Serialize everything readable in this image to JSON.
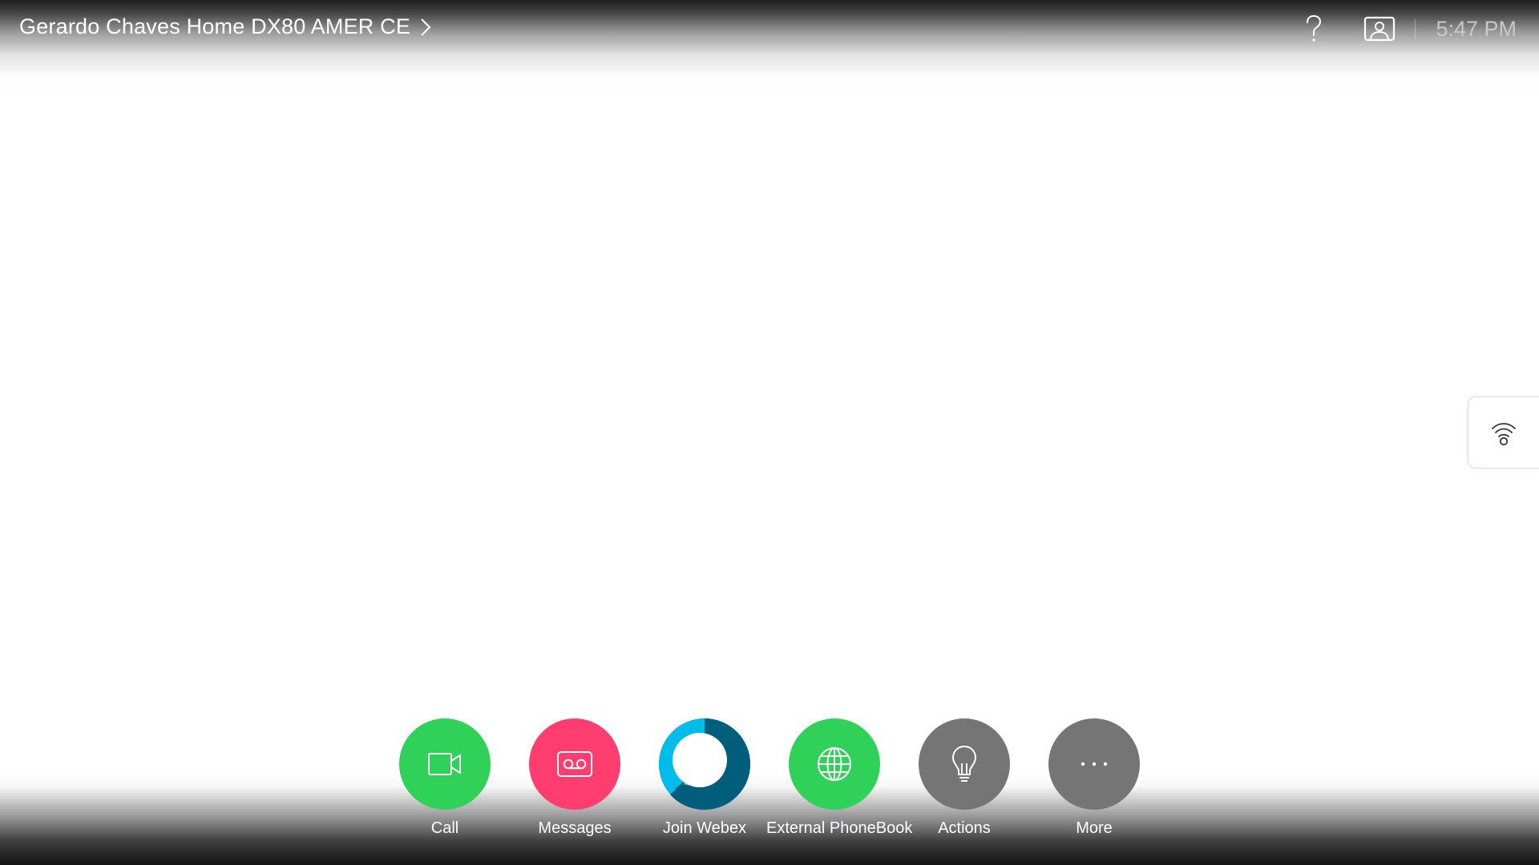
{
  "header": {
    "device_name": "Gerardo Chaves Home DX80 AMER CE",
    "time": "5:47 PM"
  },
  "icons": {
    "device_chevron": "chevron-right-icon",
    "help": "question-mark-icon",
    "selfview": "selfview-person-icon",
    "proximity": "proximity-wireless-icon"
  },
  "dock": {
    "items": [
      {
        "label": "Call",
        "icon": "video-camera-icon",
        "color": "#2fd158"
      },
      {
        "label": "Messages",
        "icon": "voicemail-icon",
        "color": "#ff3d6e"
      },
      {
        "label": "Join Webex",
        "icon": "webex-logo-icon",
        "color": "#005e7d"
      },
      {
        "label": "External PhoneBook",
        "icon": "globe-icon",
        "color": "#2fd158"
      },
      {
        "label": "Actions",
        "icon": "lightbulb-icon",
        "color": "#757575"
      },
      {
        "label": "More",
        "icon": "ellipsis-icon",
        "color": "#757575"
      }
    ]
  }
}
